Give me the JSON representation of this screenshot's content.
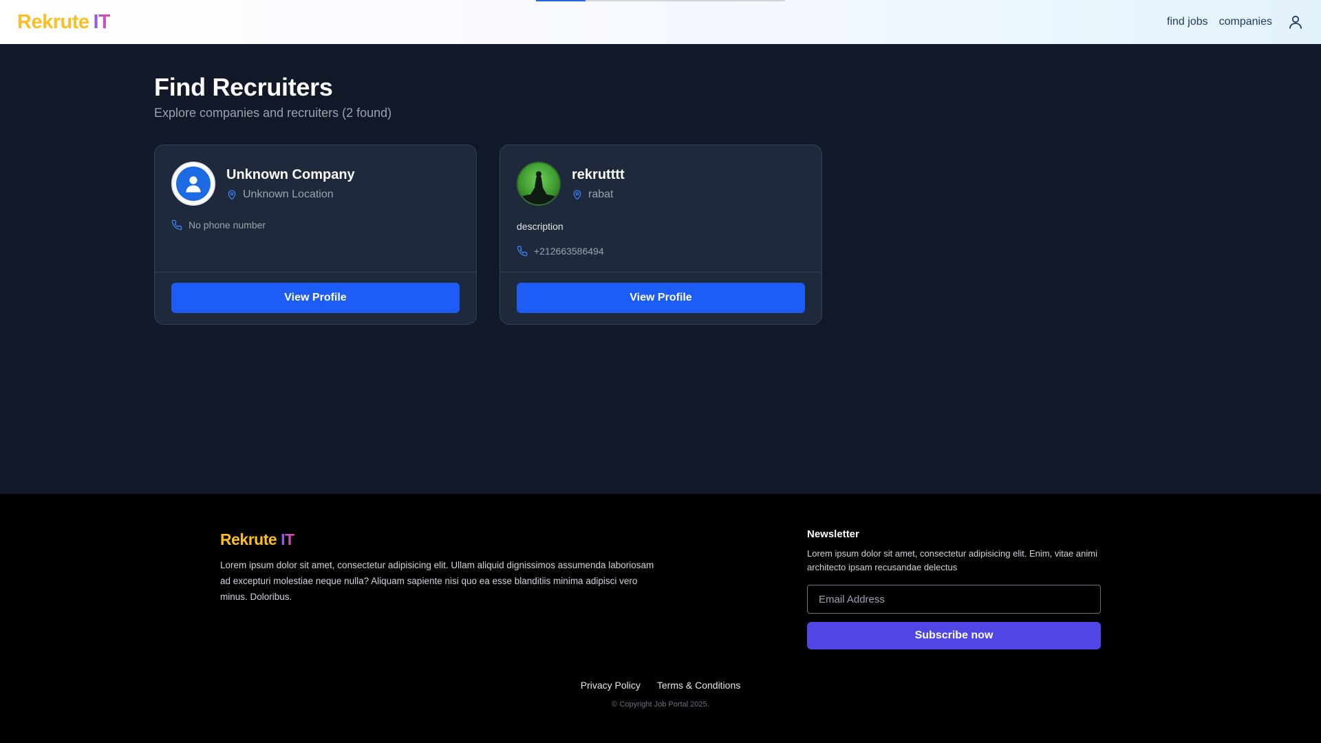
{
  "header": {
    "logo_part1": "Rekrute",
    "logo_part2": "IT",
    "progress": 0.2,
    "nav": [
      {
        "label": "find jobs"
      },
      {
        "label": "companies"
      }
    ],
    "user_icon": "user-icon"
  },
  "main": {
    "title": "Find Recruiters",
    "subtitle": "Explore companies and recruiters (2 found)",
    "cards": [
      {
        "name": "Unknown Company",
        "location": "Unknown Location",
        "description": "",
        "phone": "No phone number",
        "button_label": "View Profile",
        "avatar_icon": "user-icon"
      },
      {
        "name": "rekrutttt",
        "location": "rabat",
        "description": "description",
        "phone": "+212663586494",
        "button_label": "View Profile",
        "avatar_icon": "profile-photo"
      }
    ]
  },
  "footer": {
    "logo_part1": "Rekrute",
    "logo_part2": "IT",
    "about": "Lorem ipsum dolor sit amet, consectetur adipisicing elit. Ullam aliquid dignissimos assumenda laboriosam ad excepturi molestiae neque nulla? Aliquam sapiente nisi quo ea esse blanditiis minima adipisci vero minus. Doloribus.",
    "newsletter": {
      "title": "Newsletter",
      "text": "Lorem ipsum dolor sit amet, consectetur adipisicing elit. Enim, vitae animi architecto ipsam recusandae delectus",
      "email_placeholder": "Email Address",
      "email_value": "",
      "button_label": "Subscribe now"
    },
    "links": [
      {
        "label": "Privacy Policy"
      },
      {
        "label": "Terms & Conditions"
      }
    ],
    "copyright": "© Copyright Job Portal 2025."
  },
  "colors": {
    "page_bg": "#111827",
    "card_bg": "#1e293b",
    "primary_button": "#1d5cf5",
    "subscribe_button": "#4f46e5",
    "logo_yellow": "#fbbf24",
    "logo_gradient": [
      "#8b5cf6",
      "#ec4899"
    ]
  }
}
